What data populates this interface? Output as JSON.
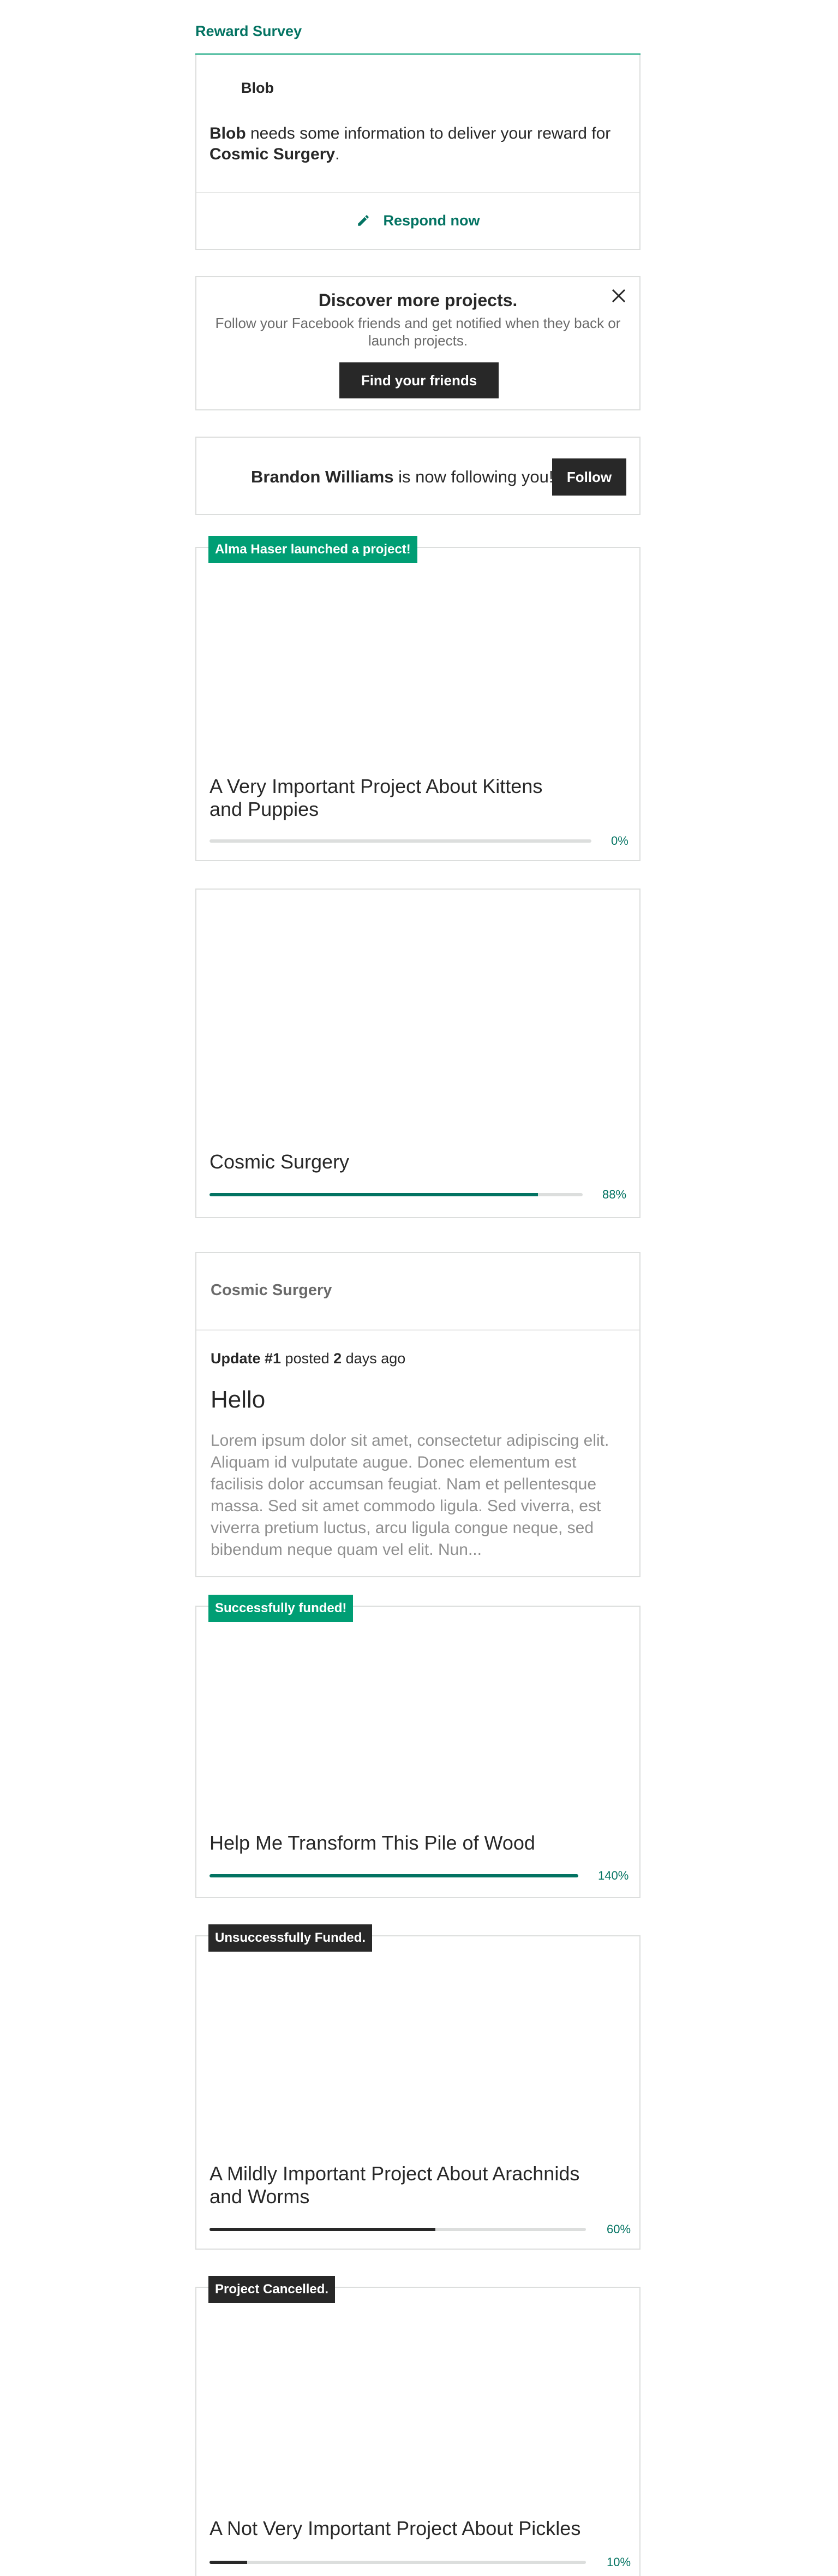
{
  "survey": {
    "title": "Reward Survey",
    "creator": "Blob",
    "message_prefix": " needs some information to deliver your reward for ",
    "project": "Cosmic Surgery",
    "message_suffix": ".",
    "action": "Respond now"
  },
  "discover": {
    "heading": "Discover more projects.",
    "text": "Follow your Facebook friends and get notified when they back or launch projects.",
    "button": "Find your friends"
  },
  "follow": {
    "name": "Brandon Williams",
    "text": " is now following you!",
    "button": "Follow"
  },
  "projects": [
    {
      "badge": "Alma Haser launched a project!",
      "title": "A Very Important Project About Kittens and Puppies",
      "percent_label": "0%",
      "progress": 0.0,
      "bar_color": "#dcdedd"
    },
    {
      "badge": "",
      "title": "Cosmic Surgery",
      "percent_label": "88%",
      "progress": 0.88,
      "bar_color": "#037362"
    },
    {
      "badge": "Successfully funded!",
      "title": "Help Me Transform This Pile of Wood",
      "percent_label": "140%",
      "progress": 1.0,
      "bar_color": "#037362"
    },
    {
      "badge": "Unsuccessfully Funded.",
      "title": "A Mildly Important Project About Arachnids and Worms",
      "percent_label": "60%",
      "progress": 0.6,
      "bar_color": "#282828"
    },
    {
      "badge": "Project Cancelled.",
      "title": "A Not Very Important Project About Pickles",
      "percent_label": "10%",
      "progress": 0.1,
      "bar_color": "#282828"
    }
  ],
  "update": {
    "project": "Cosmic Surgery",
    "label": "Update #1",
    "posted": " posted ",
    "days": "2",
    "ago": " days ago",
    "heading": "Hello",
    "body": "Lorem ipsum dolor sit amet, consectetur adipiscing elit. Aliquam id vulputate augue. Donec elementum est facilisis dolor accumsan feugiat. Nam et pellentesque massa. Sed sit amet commodo ligula. Sed viverra, est viverra pretium luctus, arcu ligula congue neque, sed bibendum neque quam vel elit. Nun..."
  },
  "colors": {
    "accent": "#009e74",
    "accent_dark": "#037362",
    "dark": "#282828",
    "border": "#dcdedd"
  },
  "icons": {
    "respond": "pencil-icon",
    "dismiss": "close-icon"
  }
}
